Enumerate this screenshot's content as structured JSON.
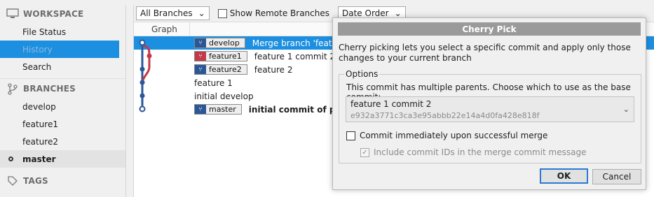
{
  "sidebar": {
    "workspace_header": "WORKSPACE",
    "workspace_items": [
      "File Status",
      "History",
      "Search"
    ],
    "branches_header": "BRANCHES",
    "branch_items": [
      "develop",
      "feature1",
      "feature2"
    ],
    "current_branch": "master",
    "tags_header": "TAGS",
    "workspace_icon": "monitor-icon",
    "branches_icon": "branch-icon",
    "tags_icon": "tag-icon"
  },
  "toolbar": {
    "branch_filter": "All Branches",
    "show_remote": "Show Remote Branches",
    "order": "Date Order"
  },
  "history": {
    "graph_header": "Graph",
    "rows": [
      {
        "label": "develop",
        "message": "Merge branch 'featur"
      },
      {
        "label": "feature1",
        "message": "feature 1 commit 2"
      },
      {
        "label": "feature2",
        "message": "feature 2"
      },
      {
        "label": "",
        "message": "feature 1"
      },
      {
        "label": "",
        "message": "initial develop"
      },
      {
        "label": "master",
        "message": "initial commit of pr"
      }
    ]
  },
  "dialog": {
    "title": "Cherry Pick",
    "description": "Cherry picking lets you select a specific commit and apply only those changes to your current branch",
    "options_legend": "Options",
    "parents_prompt": "This commit has multiple parents. Choose which to use as the base commit:",
    "selected_parent": "feature 1 commit 2",
    "selected_parent_hash": "e932a3771c3ca3e95abbb22e14a4d0fa428e818f",
    "commit_immediately": "Commit immediately upon successful merge",
    "include_ids": "Include commit IDs in the merge commit message",
    "ok_label": "OK",
    "cancel_label": "Cancel"
  },
  "colors": {
    "accent": "#1d8fe0",
    "graph_blue": "#2b5797",
    "graph_red": "#c23a4a"
  }
}
